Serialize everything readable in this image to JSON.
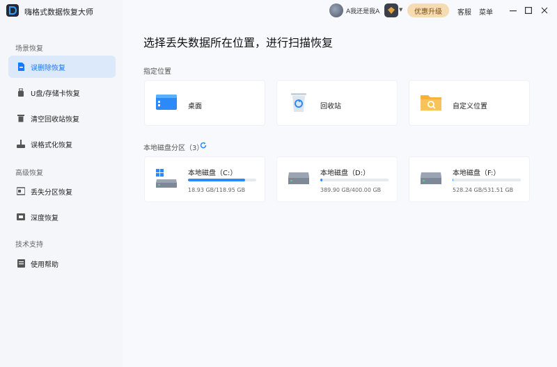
{
  "app": {
    "title": "嗨格式数据恢复大师"
  },
  "topbar": {
    "user_name": "A我还是我A",
    "upgrade_label": "优惠升级",
    "service_label": "客服",
    "menu_label": "菜单",
    "icons": [
      "avatar",
      "member-badge-icon",
      "minimize-icon",
      "maximize-icon",
      "close-icon"
    ]
  },
  "sidebar": {
    "sections": [
      {
        "label": "场景恢复",
        "items": [
          {
            "label": "误删除恢复",
            "icon": "file-delete-icon",
            "active": true
          },
          {
            "label": "U盘/存储卡恢复",
            "icon": "usb-icon"
          },
          {
            "label": "清空回收站恢复",
            "icon": "trash-icon"
          },
          {
            "label": "误格式化恢复",
            "icon": "format-icon"
          }
        ]
      },
      {
        "label": "高级恢复",
        "items": [
          {
            "label": "丢失分区恢复",
            "icon": "partition-icon"
          },
          {
            "label": "深度恢复",
            "icon": "deep-scan-icon"
          }
        ]
      },
      {
        "label": "技术支持",
        "items": [
          {
            "label": "使用帮助",
            "icon": "help-icon"
          }
        ]
      }
    ]
  },
  "main": {
    "title": "选择丢失数据所在位置，进行扫描恢复",
    "locations_label": "指定位置",
    "locations": [
      {
        "label": "桌面",
        "icon": "desktop-icon"
      },
      {
        "label": "回收站",
        "icon": "recycle-bin-icon"
      },
      {
        "label": "自定义位置",
        "icon": "folder-search-icon"
      }
    ],
    "disks_label": "本地磁盘分区（3）",
    "disks": [
      {
        "label": "本地磁盘（C:）",
        "size": "18.93 GB/118.95 GB",
        "used_fraction": 0.84,
        "icon": "windows-drive-icon"
      },
      {
        "label": "本地磁盘（D:）",
        "size": "389.90 GB/400.00 GB",
        "used_fraction": 0.03,
        "icon": "drive-icon"
      },
      {
        "label": "本地磁盘（F:）",
        "size": "528.24 GB/531.51 GB",
        "used_fraction": 0.01,
        "icon": "drive-icon"
      }
    ]
  },
  "colors": {
    "accent": "#1677ff",
    "active_bg": "#dbe9fb",
    "upgrade_bg": "#f6dcb2"
  }
}
